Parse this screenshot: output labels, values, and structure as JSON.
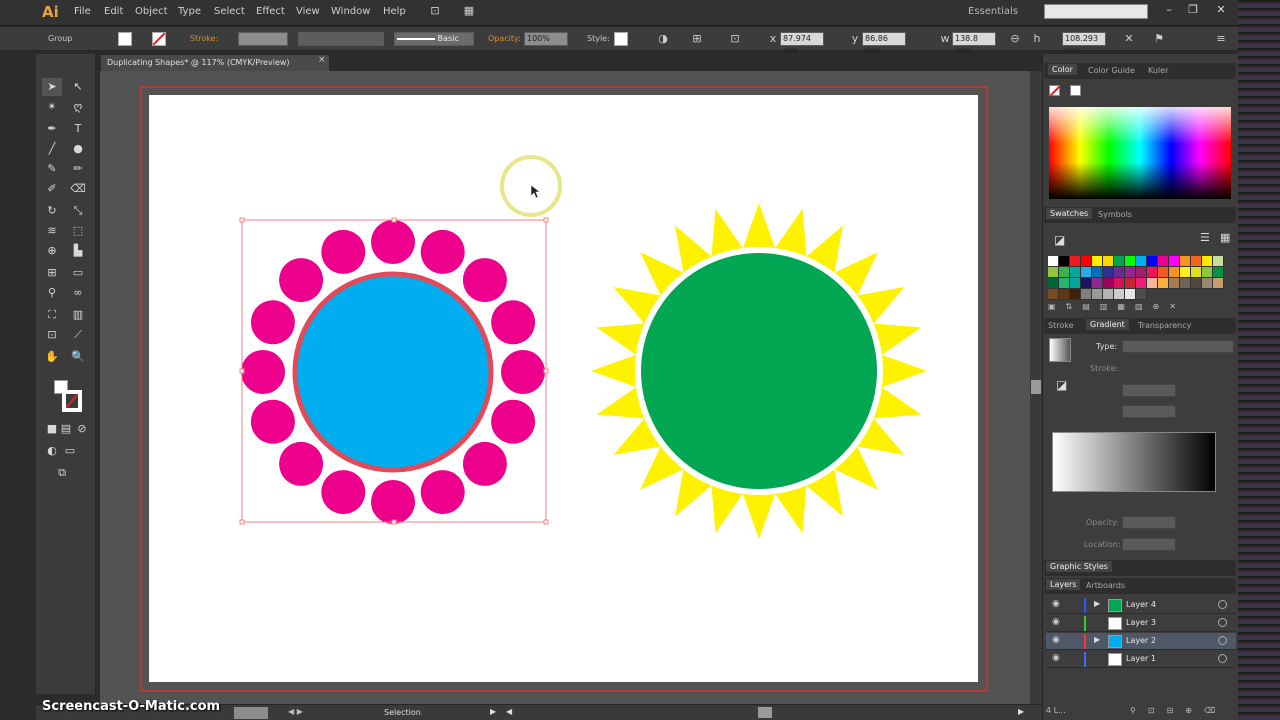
{
  "app": {
    "logo": "Ai"
  },
  "menu": [
    "File",
    "Edit",
    "Object",
    "Type",
    "Select",
    "Effect",
    "View",
    "Window",
    "Help"
  ],
  "workspace": "Essentials",
  "control_bar": {
    "selection_type": "Group",
    "stroke_label": "Stroke:",
    "brush_label": "Basic",
    "opacity_label": "Opacity:",
    "opacity_value": "100%",
    "style_label": "Style:",
    "x_value": "87.974 mm",
    "y_value": "86.86 mm",
    "w_value": "138.8 mm",
    "h_value": "108.293 mm"
  },
  "document": {
    "tab_title": "Duplicating Shapes* @ 117% (CMYK/Preview)"
  },
  "artwork": {
    "left_center_color": "#00AEEF",
    "left_center_stroke": "#E04A5A",
    "petal_color": "#EC008C",
    "right_center_color": "#00A651",
    "ray_color": "#FFF200",
    "selection_color": "#F08080"
  },
  "panels": {
    "color_tabs": [
      "Color",
      "Color Guide",
      "Kuler"
    ],
    "swatch_tabs": [
      "Swatches",
      "Symbols"
    ],
    "gradient_tabs": [
      "Stroke",
      "Gradient",
      "Transparency"
    ],
    "gradient": {
      "type_label": "Type:",
      "stroke_label": "Stroke:",
      "opacity_label": "Opacity:",
      "location_label": "Location:"
    },
    "graphic_styles": "Graphic Styles",
    "layer_tabs": [
      "Layers",
      "Artboards"
    ],
    "layers": [
      {
        "name": "Layer 4",
        "color": "#3355ff",
        "thumb": "#00A651",
        "expandable": true
      },
      {
        "name": "Layer 3",
        "color": "#33cc33",
        "thumb": "#ffffff",
        "expandable": false
      },
      {
        "name": "Layer 2",
        "color": "#ff3333",
        "thumb": "#00AEEF",
        "expandable": true
      },
      {
        "name": "Layer 1",
        "color": "#4466ff",
        "thumb": "#ffffff",
        "expandable": false
      }
    ]
  },
  "status": {
    "tool": "Selection"
  },
  "watermark": "Screencast-O-Matic.com",
  "swatches": [
    "#ffffff",
    "#000000",
    "#ed1c24",
    "#ff0000",
    "#fff200",
    "#ffd700",
    "#00a651",
    "#00ff00",
    "#00aeef",
    "#0000ff",
    "#ec008c",
    "#ff00ff",
    "#f7941d",
    "#f26522",
    "#ffe600",
    "#c4df9b",
    "#8dc63f",
    "#39b54a",
    "#00a99d",
    "#29abe2",
    "#0072bc",
    "#2e3192",
    "#662d91",
    "#92278f",
    "#9e1f63",
    "#ed145b",
    "#f15a24",
    "#f7931e",
    "#fcee21",
    "#d9e021",
    "#8cc63f",
    "#009245",
    "#006837",
    "#22b573",
    "#00a99d",
    "#1b1464",
    "#93278f",
    "#9e005d",
    "#d4145a",
    "#c1272d",
    "#ed1e79",
    "#f7b59b",
    "#fbb03b",
    "#a67c52",
    "#736357",
    "#534741",
    "#998675",
    "#c69c6d",
    "#754c24",
    "#603813",
    "#42210b",
    "#808080",
    "#999999",
    "#b3b3b3",
    "#cccccc",
    "#e6e6e6",
    "#4d4d4d"
  ]
}
